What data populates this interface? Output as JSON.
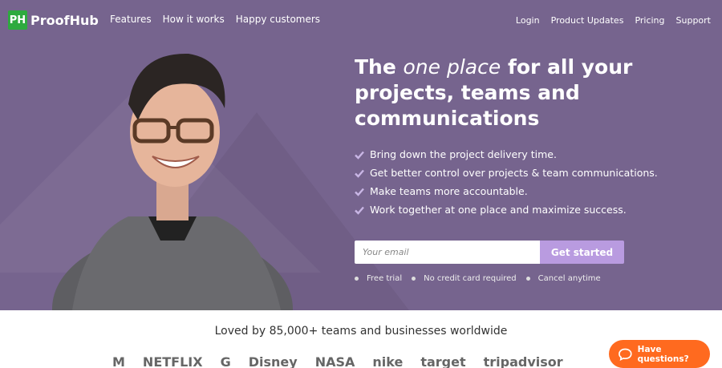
{
  "brand": {
    "badge": "PH",
    "name": "ProofHub"
  },
  "nav_left": [
    "Features",
    "How it works",
    "Happy customers"
  ],
  "nav_right": [
    "Login",
    "Product Updates",
    "Pricing",
    "Support"
  ],
  "headline": {
    "pre": "The ",
    "emph": "one place",
    "post": " for all your projects, teams and communications"
  },
  "benefits": [
    "Bring down the project delivery time.",
    "Get better control over projects & team communications.",
    "Make teams more accountable.",
    "Work together at one place and maximize success."
  ],
  "signup": {
    "email_placeholder": "Your email",
    "button": "Get started"
  },
  "perks": [
    "Free trial",
    "No credit card required",
    "Cancel anytime"
  ],
  "social_proof": "Loved by 85,000+ teams and businesses worldwide",
  "client_logos": [
    "M",
    "NETFLIX",
    "G",
    "Disney",
    "NASA",
    "nike",
    "target",
    "tripadvisor"
  ],
  "chat": {
    "label": "Have questions?"
  },
  "colors": {
    "hero_bg": "#76648e",
    "cta": "#b99be0",
    "brand_green": "#2eaa3f",
    "chat": "#ff6a1f"
  }
}
